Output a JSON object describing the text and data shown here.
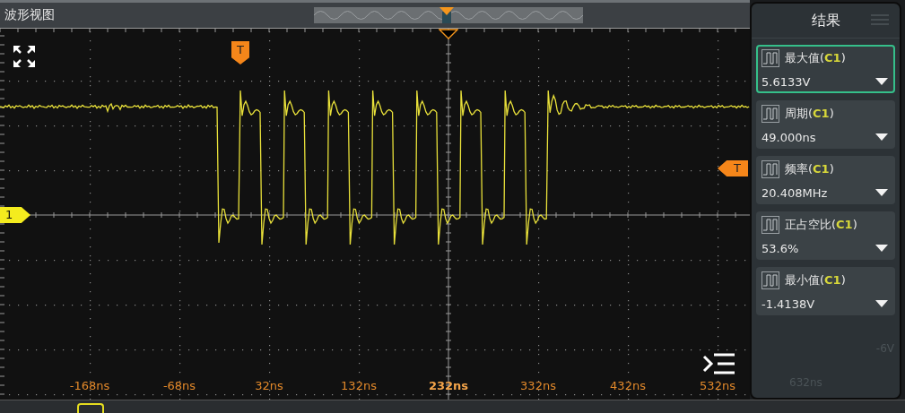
{
  "title": "波形视图",
  "trigger_marker": {
    "label": "T"
  },
  "level_marker": {
    "label": "T"
  },
  "channel_marker": {
    "label": "1"
  },
  "time_axis": [
    {
      "label": "-168ns",
      "highlighted": false
    },
    {
      "label": "-68ns",
      "highlighted": false
    },
    {
      "label": "32ns",
      "highlighted": false
    },
    {
      "label": "132ns",
      "highlighted": false
    },
    {
      "label": "232ns",
      "highlighted": true
    },
    {
      "label": "332ns",
      "highlighted": false
    },
    {
      "label": "432ns",
      "highlighted": false
    },
    {
      "label": "532ns",
      "highlighted": false
    }
  ],
  "panel": {
    "title": "结果",
    "faded_time_label": "632ns",
    "faded_volt_label": "-6V",
    "measurements": [
      {
        "name": "最大值(**C1**)",
        "value": "5.6133V",
        "selected": true
      },
      {
        "name": "周期(**C1**)",
        "value": "49.000ns",
        "selected": false
      },
      {
        "name": "频率(**C1**)",
        "value": "20.408MHz",
        "selected": false
      },
      {
        "name": "正占空比(**C1**)",
        "value": "53.6%",
        "selected": false
      },
      {
        "name": "最小值(**C1**)",
        "value": "-1.4138V",
        "selected": false
      }
    ]
  }
}
